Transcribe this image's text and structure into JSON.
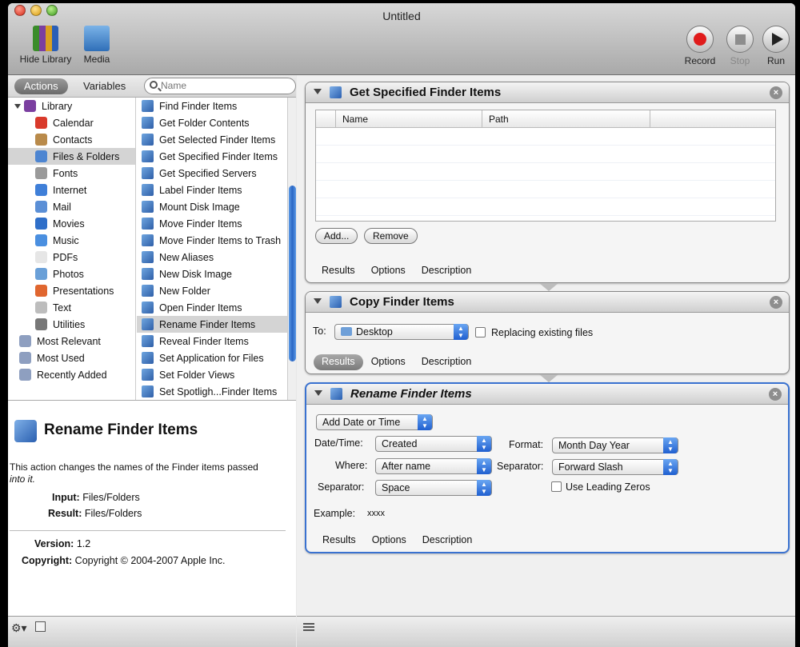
{
  "window": {
    "title": "Untitled"
  },
  "toolbar": {
    "hide_library": "Hide Library",
    "media": "Media",
    "record": "Record",
    "stop": "Stop",
    "run": "Run"
  },
  "library": {
    "tab_actions": "Actions",
    "tab_variables": "Variables",
    "search_placeholder": "Name",
    "categories": [
      {
        "label": "Library",
        "icon": "library-icon",
        "color": "#7b3fa0"
      },
      {
        "label": "Calendar",
        "icon": "calendar-icon",
        "color": "#d93a2b"
      },
      {
        "label": "Contacts",
        "icon": "contacts-icon",
        "color": "#b98a4a"
      },
      {
        "label": "Files & Folders",
        "icon": "finder-icon",
        "color": "#4d85d1"
      },
      {
        "label": "Fonts",
        "icon": "fonts-icon",
        "color": "#9a9a9a"
      },
      {
        "label": "Internet",
        "icon": "internet-icon",
        "color": "#3f7fd8"
      },
      {
        "label": "Mail",
        "icon": "mail-icon",
        "color": "#5b8fd6"
      },
      {
        "label": "Movies",
        "icon": "movies-icon",
        "color": "#2f6fc9"
      },
      {
        "label": "Music",
        "icon": "music-icon",
        "color": "#4a8fe0"
      },
      {
        "label": "PDFs",
        "icon": "pdf-icon",
        "color": "#e6e6e6"
      },
      {
        "label": "Photos",
        "icon": "photos-icon",
        "color": "#6aa0d8"
      },
      {
        "label": "Presentations",
        "icon": "presentations-icon",
        "color": "#e0662f"
      },
      {
        "label": "Text",
        "icon": "text-icon",
        "color": "#bdbdbd"
      },
      {
        "label": "Utilities",
        "icon": "utilities-icon",
        "color": "#777777"
      },
      {
        "label": "Most Relevant",
        "icon": "smart-folder-icon",
        "color": "#8e9fc0"
      },
      {
        "label": "Most Used",
        "icon": "smart-folder-icon",
        "color": "#8e9fc0"
      },
      {
        "label": "Recently Added",
        "icon": "smart-folder-icon",
        "color": "#8e9fc0"
      }
    ],
    "actions": [
      "Find Finder Items",
      "Get Folder Contents",
      "Get Selected Finder Items",
      "Get Specified Finder Items",
      "Get Specified Servers",
      "Label Finder Items",
      "Mount Disk Image",
      "Move Finder Items",
      "Move Finder Items to Trash",
      "New Aliases",
      "New Disk Image",
      "New Folder",
      "Open Finder Items",
      "Rename Finder Items",
      "Reveal Finder Items",
      "Set Application for Files",
      "Set Folder Views",
      "Set Spotligh...Finder Items"
    ],
    "description": {
      "title": "Rename Finder Items",
      "text": "This action changes the names of the Finder items passed",
      "text_em": "into it.",
      "input_label": "Input:",
      "input_value": "Files/Folders",
      "result_label": "Result:",
      "result_value": "Files/Folders",
      "version_label": "Version:",
      "version_value": "1.2",
      "copyright_label": "Copyright:",
      "copyright_value": "Copyright © 2004-2007 Apple Inc."
    }
  },
  "workflow": {
    "tab_results": "Results",
    "tab_options": "Options",
    "tab_description": "Description",
    "get_specified": {
      "title": "Get Specified Finder Items",
      "col_name": "Name",
      "col_path": "Path",
      "add": "Add...",
      "remove": "Remove"
    },
    "copy": {
      "title": "Copy Finder Items",
      "to_label": "To:",
      "to_value": "Desktop",
      "replacing": "Replacing existing files"
    },
    "rename": {
      "title": "Rename Finder Items",
      "mode": "Add Date or Time",
      "datetime_label": "Date/Time:",
      "datetime_value": "Created",
      "where_label": "Where:",
      "where_value": "After name",
      "separator_label": "Separator:",
      "separator_value": "Space",
      "format_label": "Format:",
      "format_value": "Month Day Year",
      "separator2_label": "Separator:",
      "separator2_value": "Forward Slash",
      "leading_zeros": "Use Leading Zeros",
      "example_label": "Example:",
      "example_value": "xxxx"
    }
  }
}
